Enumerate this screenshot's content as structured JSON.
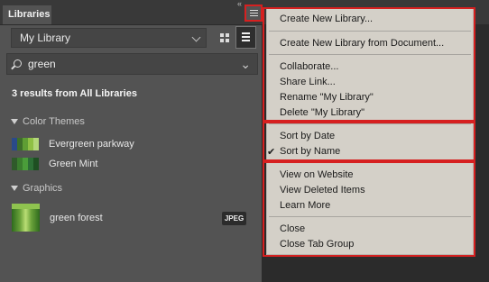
{
  "tab": {
    "label": "Libraries"
  },
  "tab_grip": "«",
  "library": {
    "selected": "My Library"
  },
  "search": {
    "value": "green",
    "clear": "⌄"
  },
  "results_text": "3 results from All Libraries",
  "sections": {
    "color_themes": {
      "title": "Color Themes",
      "items": [
        {
          "name": "Evergreen parkway",
          "colors": [
            "#2a4a8a",
            "#3e6f2a",
            "#5f9e34",
            "#8fc045",
            "#b3d77a"
          ]
        },
        {
          "name": "Green Mint",
          "colors": [
            "#2f5a2a",
            "#3a7d2e",
            "#4a9d3a",
            "#2c6e35",
            "#1e4f22"
          ]
        }
      ]
    },
    "graphics": {
      "title": "Graphics",
      "items": [
        {
          "name": "green forest",
          "badge": "JPEG"
        }
      ]
    }
  },
  "menu": {
    "create_new": "Create New Library...",
    "create_from_doc": "Create New Library from Document...",
    "collaborate": "Collaborate...",
    "share_link": "Share Link...",
    "rename": "Rename \"My Library\"",
    "delete": "Delete \"My Library\"",
    "sort_date": "Sort by Date",
    "sort_name": "Sort by Name",
    "sort_name_checked": "✔",
    "view_website": "View on Website",
    "view_deleted": "View Deleted Items",
    "learn_more": "Learn More",
    "close": "Close",
    "close_group": "Close Tab Group"
  },
  "colors": {
    "highlight": "#d62020",
    "panel": "#535353",
    "menu_bg": "#d4d0c8"
  }
}
